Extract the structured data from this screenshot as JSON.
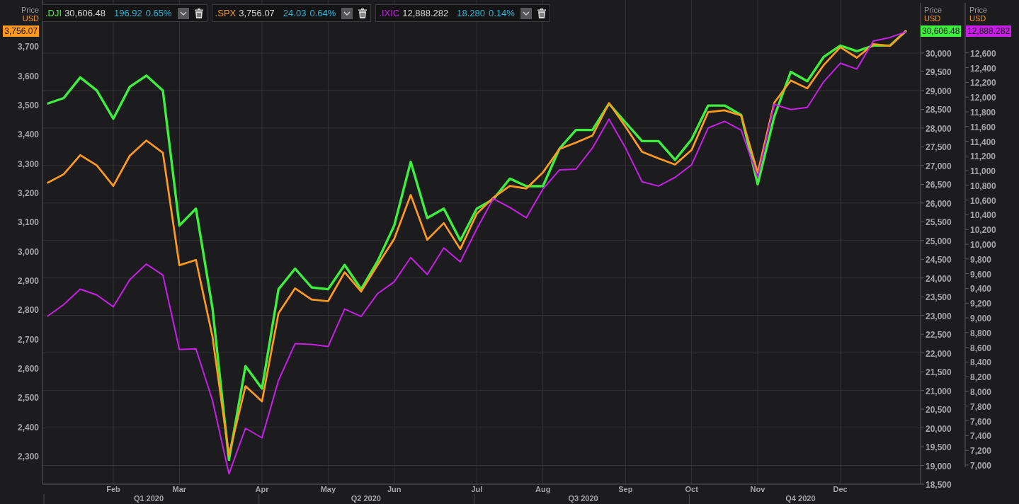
{
  "legend": [
    {
      "price": "30,606.48",
      "change": "196.92",
      "percent": "0.65%"
    },
    {
      "price": "3,756.07",
      "change": "24.03",
      "percent": "0.64%"
    },
    {
      "price": "12,888.282",
      "change": "18.280",
      "percent": "0.14%"
    }
  ],
  "axes": [
    {
      "title": "Price",
      "unit": "USD",
      "badge": "3,756.07",
      "color": "#ff9a1f"
    },
    {
      "title": "Price",
      "unit": "USD",
      "badge": "30,606.48",
      "color": "#3ef03e"
    },
    {
      "title": "Price",
      "unit": "USD",
      "badge": "12,888.282",
      "color": "#c81ee8"
    }
  ],
  "chart_data": {
    "type": "line",
    "grid": true,
    "categories": [
      null,
      null,
      null,
      null,
      "Feb",
      null,
      null,
      null,
      "Mar",
      null,
      null,
      null,
      null,
      "Apr",
      null,
      null,
      null,
      "May",
      null,
      null,
      null,
      "Jun",
      null,
      null,
      null,
      null,
      "Jul",
      null,
      null,
      null,
      "Aug",
      null,
      null,
      null,
      null,
      "Sep",
      null,
      null,
      null,
      "Oct",
      null,
      null,
      null,
      "Nov",
      null,
      null,
      null,
      null,
      "Dec",
      null,
      null,
      null,
      null
    ],
    "annotations": [
      "Q1 2020",
      "Q2 2020",
      "Q3 2020",
      "Q4 2020"
    ],
    "ylim": [
      2206,
      3860
    ],
    "yticks": [
      {
        "value": 2300,
        "label": "2,300"
      },
      {
        "value": 2400,
        "label": "2,400"
      },
      {
        "value": 2500,
        "label": "2,500"
      },
      {
        "value": 2600,
        "label": "2,600"
      },
      {
        "value": 2700,
        "label": "2,700"
      },
      {
        "value": 2800,
        "label": "2,800"
      },
      {
        "value": 2900,
        "label": "2,900"
      },
      {
        "value": 3000,
        "label": "3,000"
      },
      {
        "value": 3100,
        "label": "3,100"
      },
      {
        "value": 3200,
        "label": "3,200"
      },
      {
        "value": 3300,
        "label": "3,300"
      },
      {
        "value": 3400,
        "label": "3,400"
      },
      {
        "value": 3500,
        "label": "3,500"
      },
      {
        "value": 3600,
        "label": "3,600"
      },
      {
        "value": 3700,
        "label": "3,700"
      }
    ],
    "y2lim": [
      18500,
      31416
    ],
    "y2ticks": [
      {
        "value": 18500,
        "label": "18,500"
      },
      {
        "value": 19000,
        "label": "19,000"
      },
      {
        "value": 19500,
        "label": "19,500"
      },
      {
        "value": 20000,
        "label": "20,000"
      },
      {
        "value": 20500,
        "label": "20,500"
      },
      {
        "value": 21000,
        "label": "21,000"
      },
      {
        "value": 21500,
        "label": "21,500"
      },
      {
        "value": 22000,
        "label": "22,000"
      },
      {
        "value": 22500,
        "label": "22,500"
      },
      {
        "value": 23000,
        "label": "23,000"
      },
      {
        "value": 23500,
        "label": "23,500"
      },
      {
        "value": 24000,
        "label": "24,000"
      },
      {
        "value": 24500,
        "label": "24,500"
      },
      {
        "value": 25000,
        "label": "25,000"
      },
      {
        "value": 25500,
        "label": "25,500"
      },
      {
        "value": 26000,
        "label": "26,000"
      },
      {
        "value": 26500,
        "label": "26,500"
      },
      {
        "value": 27000,
        "label": "27,000"
      },
      {
        "value": 27500,
        "label": "27,500"
      },
      {
        "value": 28000,
        "label": "28,000"
      },
      {
        "value": 28500,
        "label": "28,500"
      },
      {
        "value": 29000,
        "label": "29,000"
      },
      {
        "value": 29500,
        "label": "29,500"
      },
      {
        "value": 30000,
        "label": "30,000"
      }
    ],
    "y3lim": [
      6740,
      13319
    ],
    "y3ticks": [
      {
        "value": 7000,
        "label": "7,000"
      },
      {
        "value": 7200,
        "label": "7,200"
      },
      {
        "value": 7400,
        "label": "7,400"
      },
      {
        "value": 7600,
        "label": "7,600"
      },
      {
        "value": 7800,
        "label": "7,800"
      },
      {
        "value": 8000,
        "label": "8,000"
      },
      {
        "value": 8200,
        "label": "8,200"
      },
      {
        "value": 8400,
        "label": "8,400"
      },
      {
        "value": 8600,
        "label": "8,600"
      },
      {
        "value": 8800,
        "label": "8,800"
      },
      {
        "value": 9000,
        "label": "9,000"
      },
      {
        "value": 9200,
        "label": "9,200"
      },
      {
        "value": 9400,
        "label": "9,400"
      },
      {
        "value": 9600,
        "label": "9,600"
      },
      {
        "value": 9800,
        "label": "9,800"
      },
      {
        "value": 10000,
        "label": "10,000"
      },
      {
        "value": 10200,
        "label": "10,200"
      },
      {
        "value": 10400,
        "label": "10,400"
      },
      {
        "value": 10600,
        "label": "10,600"
      },
      {
        "value": 10800,
        "label": "10,800"
      },
      {
        "value": 11000,
        "label": "11,000"
      },
      {
        "value": 11200,
        "label": "11,200"
      },
      {
        "value": 11400,
        "label": "11,400"
      },
      {
        "value": 11600,
        "label": "11,600"
      },
      {
        "value": 11800,
        "label": "11,800"
      },
      {
        "value": 12000,
        "label": "12,000"
      },
      {
        "value": 12200,
        "label": "12,200"
      },
      {
        "value": 12400,
        "label": "12,400"
      },
      {
        "value": 12600,
        "label": "12,600"
      }
    ],
    "series": [
      {
        "name": ".DJI",
        "color": "#3ef03e",
        "axis": "y2",
        "values": [
          28650,
          28800,
          29350,
          29000,
          28250,
          29100,
          29400,
          29000,
          25400,
          25850,
          23200,
          19150,
          21650,
          21050,
          23700,
          24250,
          23750,
          23700,
          24350,
          23700,
          24450,
          25400,
          27100,
          25600,
          25850,
          25000,
          25850,
          26100,
          26650,
          26450,
          26450,
          27450,
          27950,
          27950,
          28650,
          28150,
          27650,
          27650,
          27150,
          27700,
          28600,
          28600,
          28350,
          26500,
          28300,
          29500,
          29250,
          29900,
          30200,
          30050,
          30200,
          30200,
          30600
        ]
      },
      {
        "name": ".SPX",
        "color": "#ff9a1f",
        "values": [
          3235,
          3265,
          3330,
          3295,
          3225,
          3328,
          3380,
          3338,
          2954,
          2972,
          2711,
          2305,
          2541,
          2489,
          2790,
          2875,
          2837,
          2831,
          2930,
          2864,
          2955,
          3044,
          3194,
          3041,
          3098,
          3009,
          3130,
          3185,
          3225,
          3216,
          3271,
          3351,
          3373,
          3397,
          3508,
          3427,
          3341,
          3319,
          3298,
          3348,
          3477,
          3483,
          3465,
          3270,
          3509,
          3585,
          3558,
          3638,
          3699,
          3663,
          3709,
          3703,
          3756
        ]
      },
      {
        "name": ".IXIC",
        "color": "#c81ee8",
        "axis": "y3",
        "values": [
          9020,
          9180,
          9390,
          9310,
          9150,
          9520,
          9730,
          9580,
          8570,
          8580,
          7880,
          6880,
          7500,
          7370,
          8150,
          8650,
          8640,
          8610,
          9120,
          9020,
          9330,
          9490,
          9820,
          9590,
          9950,
          9760,
          10210,
          10620,
          10500,
          10360,
          10750,
          11010,
          11020,
          11310,
          11700,
          11310,
          10850,
          10790,
          10910,
          11080,
          11580,
          11670,
          11550,
          10910,
          11900,
          11830,
          11860,
          12210,
          12460,
          12380,
          12760,
          12810,
          12890
        ]
      }
    ]
  }
}
